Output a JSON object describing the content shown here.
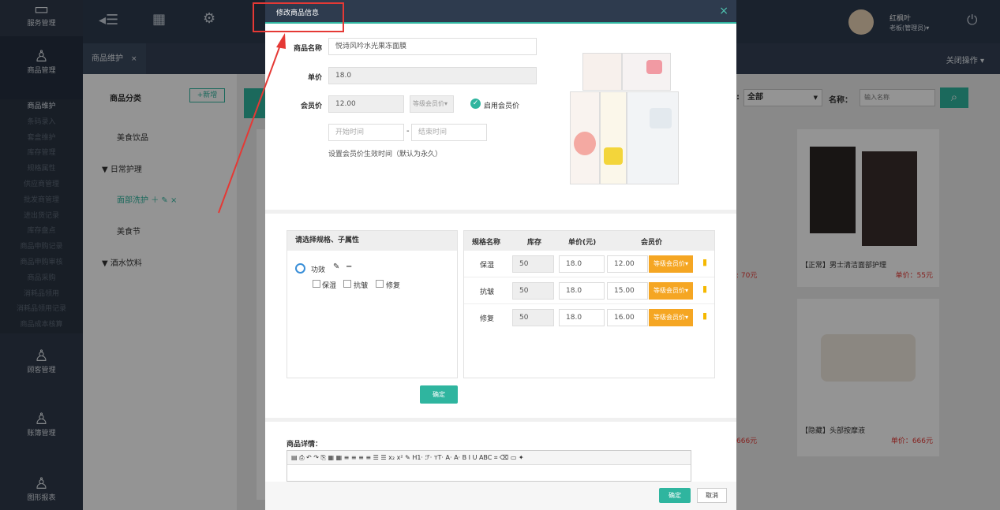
{
  "sidebar": {
    "modules": [
      {
        "label": "服务管理"
      },
      {
        "label": "商品管理"
      },
      {
        "label": "顾客管理"
      },
      {
        "label": "账簿管理"
      },
      {
        "label": "图形报表"
      }
    ],
    "submenu": [
      "商品维护",
      "条码录入",
      "套盒维护",
      "库存管理",
      "规格属性",
      "供应商管理",
      "批发商管理",
      "进出货记录",
      "库存盘点",
      "商品申购记录",
      "商品申购审核",
      "商品采购",
      "消耗品领用",
      "消耗品领用记录",
      "商品成本核算"
    ]
  },
  "header": {
    "user_name": "红枫叶",
    "user_role": "老板(管理员)▾"
  },
  "tabs": {
    "active": "商品维护",
    "close_all": "关闭操作 ▾"
  },
  "category": {
    "title": "商品分类",
    "add_button": "+新增",
    "items": [
      "美食饮品",
      "日常护理",
      "面部洗护",
      "美食节",
      "酒水饮料"
    ]
  },
  "filter": {
    "select_value": "全部",
    "name_label": "名称：",
    "name_placeholder": "输入名称",
    "colon": ":"
  },
  "products": [
    {
      "title": "【正常】男士清洁面部护理",
      "price": "单价：55元"
    },
    {
      "title": "【隐藏】头部按摩液",
      "price": "单价：666元"
    }
  ],
  "partial_prices": [
    ": 70元",
    "666元",
    "666元"
  ],
  "modal": {
    "title": "修改商品信息",
    "close": "×",
    "fields": {
      "name_label": "商品名称",
      "name_value": "悦诗风吟水光果冻面膜",
      "price_label": "单价",
      "price_value": "18.0",
      "member_label": "会员价",
      "member_value": "12.00",
      "member_level": "等级会员价▾",
      "enable_member": "启用会员价",
      "start_placeholder": "开始时间",
      "end_placeholder": "结束时间",
      "dash": "-",
      "hint": "设置会员价生效时间（默认为永久）"
    },
    "spec": {
      "header": "请选择规格、子属性",
      "attr_name": "功效",
      "options": [
        "保湿",
        "抗皱",
        "修复"
      ],
      "confirm": "确定"
    },
    "spec_table": {
      "columns": [
        "规格名称",
        "库存",
        "单价(元)",
        "会员价"
      ],
      "rows": [
        {
          "name": "保湿",
          "stock": "50",
          "price": "18.0",
          "member": "12.00",
          "level": "等级会员价▾"
        },
        {
          "name": "抗皱",
          "stock": "50",
          "price": "18.0",
          "member": "15.00",
          "level": "等级会员价▾"
        },
        {
          "name": "修复",
          "stock": "50",
          "price": "18.0",
          "member": "16.00",
          "level": "等级会员价▾"
        }
      ]
    },
    "detail_label": "商品详情：",
    "toolbar_text": "H1· ℱ· тT· A· A· B I U ABC",
    "footer": {
      "ok": "确定",
      "cancel": "取消"
    }
  }
}
